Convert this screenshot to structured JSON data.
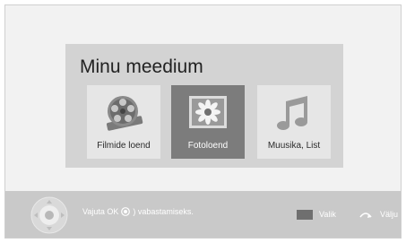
{
  "menu": {
    "title": "Minu meedium",
    "items": [
      {
        "label": "Filmide loend",
        "icon": "film-reel-icon",
        "selected": false
      },
      {
        "label": "Fotoloend",
        "icon": "photo-icon",
        "selected": true
      },
      {
        "label": "Muusika, List",
        "icon": "music-note-icon",
        "selected": false
      }
    ]
  },
  "bottom_bar": {
    "hint_prefix": "Vajuta OK",
    "hint_suffix": ") vabastamiseks.",
    "select_label": "Valik",
    "exit_label": "Välju"
  },
  "colors": {
    "screen_background": "#f2f2f2",
    "panel_background": "#d3d3d3",
    "tile_background": "#e6e6e6",
    "selected_tile": "#7c7c7c",
    "bottom_bar": "#c9c9c9"
  }
}
